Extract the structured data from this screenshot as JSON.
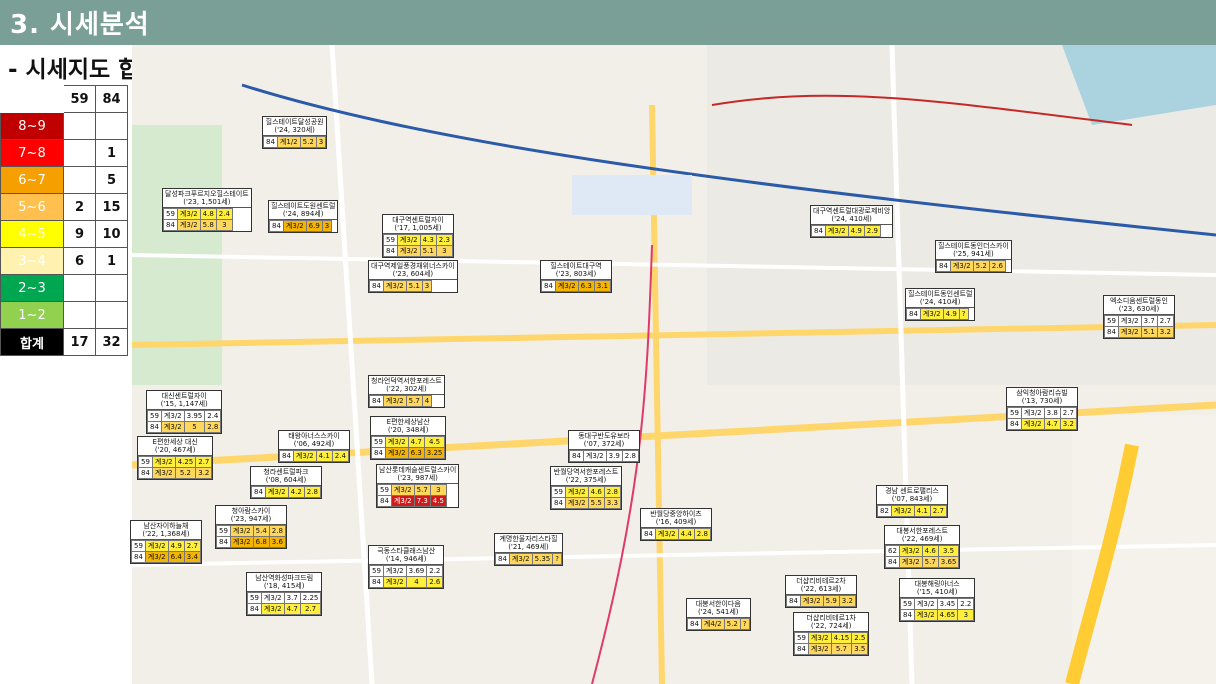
{
  "header": {
    "title": "3. 시세분석"
  },
  "subtitle": "- 시세지도 합치기",
  "legend": {
    "columns": [
      "59",
      "84"
    ],
    "rows": [
      {
        "label": "8~9",
        "color": "#c00000",
        "v59": "",
        "v84": ""
      },
      {
        "label": "7~8",
        "color": "#ff0000",
        "v59": "",
        "v84": "1"
      },
      {
        "label": "6~7",
        "color": "#f5a000",
        "v59": "",
        "v84": "5"
      },
      {
        "label": "5~6",
        "color": "#ffc04d",
        "v59": "2",
        "v84": "15"
      },
      {
        "label": "4~5",
        "color": "#ffff00",
        "v59": "9",
        "v84": "10"
      },
      {
        "label": "3~4",
        "color": "#fff2b0",
        "v59": "6",
        "v84": "1"
      },
      {
        "label": "2~3",
        "color": "#00a650",
        "v59": "",
        "v84": ""
      },
      {
        "label": "1~2",
        "color": "#92d050",
        "v59": "",
        "v84": ""
      }
    ],
    "total": {
      "label": "합계",
      "v59": "17",
      "v84": "32"
    }
  },
  "listings": [
    {
      "name": "힐스테이트달성공원",
      "year": "('24, 320세)",
      "rows": [
        [
          "84",
          "계1/2",
          "5.2",
          "3"
        ]
      ]
    },
    {
      "name": "달성파크푸르지오힐스테이트",
      "year": "('23, 1,501세)",
      "rows": [
        [
          "59",
          "계3/2",
          "4.8",
          "2.4"
        ],
        [
          "84",
          "계3/2",
          "5.8",
          "3"
        ]
      ]
    },
    {
      "name": "힐스테이트도원센트럴",
      "year": "('24, 894세)",
      "rows": [
        [
          "84",
          "계3/2",
          "6.9",
          "3"
        ]
      ]
    },
    {
      "name": "대구역센트럴자이",
      "year": "('17, 1,005세)",
      "rows": [
        [
          "59",
          "계3/2",
          "4.3",
          "2.3"
        ],
        [
          "84",
          "계3/2",
          "5.1",
          "3"
        ]
      ]
    },
    {
      "name": "대구역제일풍경채위너스카이",
      "year": "('23, 604세)",
      "rows": [
        [
          "84",
          "계3/2",
          "5.1",
          "3"
        ]
      ]
    },
    {
      "name": "힐스테이트대구역",
      "year": "('23, 803세)",
      "rows": [
        [
          "84",
          "계3/2",
          "6.3",
          "3.1"
        ]
      ]
    },
    {
      "name": "대구역센트럴대광로제비앙",
      "year": "('24, 410세)",
      "rows": [
        [
          "84",
          "계3/2",
          "4.9",
          "2.9"
        ]
      ]
    },
    {
      "name": "힐스테이트동인센트럴",
      "year": "('24, 410세)",
      "rows": [
        [
          "84",
          "계3/2",
          "4.9",
          "?"
        ]
      ]
    },
    {
      "name": "힐스테이트동인더스카이",
      "year": "('25, 941세)",
      "rows": [
        [
          "84",
          "계3/2",
          "5.2",
          "2.6"
        ]
      ]
    },
    {
      "name": "엑소디움센트럴동인",
      "year": "('23, 630세)",
      "rows": [
        [
          "59",
          "계3/2",
          "3.7",
          "2.7"
        ],
        [
          "84",
          "계3/2",
          "5.1",
          "3.2"
        ]
      ]
    },
    {
      "name": "청라언덕역서한포레스트",
      "year": "('22, 302세)",
      "rows": [
        [
          "84",
          "계3/2",
          "5.7",
          "4"
        ]
      ]
    },
    {
      "name": "대신센트럴자이",
      "year": "('15, 1,147세)",
      "rows": [
        [
          "59",
          "계3/2",
          "3.95",
          "2.4"
        ],
        [
          "84",
          "계3/2",
          "5",
          "2.8"
        ]
      ]
    },
    {
      "name": "E편한세상 대신",
      "year": "('20, 467세)",
      "rows": [
        [
          "59",
          "계3/2",
          "4.25",
          "2.7"
        ],
        [
          "84",
          "계3/2",
          "5.2",
          "3.2"
        ]
      ]
    },
    {
      "name": "태왕아너스스카이",
      "year": "('06, 492세)",
      "rows": [
        [
          "84",
          "계3/2",
          "4.1",
          "2.4"
        ]
      ]
    },
    {
      "name": "E편한세상남산",
      "year": "('20, 348세)",
      "rows": [
        [
          "59",
          "계3/2",
          "4.7",
          "4.5"
        ],
        [
          "84",
          "계3/2",
          "6.3",
          "3.25"
        ]
      ]
    },
    {
      "name": "청라센트럴파크",
      "year": "('08, 604세)",
      "rows": [
        [
          "84",
          "계3/2",
          "4.2",
          "2.8"
        ]
      ]
    },
    {
      "name": "남산롯데캐슬센트럴스카이",
      "year": "('23, 987세)",
      "rows": [
        [
          "59",
          "계3/2",
          "5.7",
          "3"
        ],
        [
          "84",
          "계3/2",
          "7.3",
          "4.5"
        ]
      ]
    },
    {
      "name": "동대구반도유보라",
      "year": "('07, 372세)",
      "rows": [
        [
          "84",
          "계3/2",
          "3.9",
          "2.8"
        ]
      ]
    },
    {
      "name": "반월당역서한포레스트",
      "year": "('22, 375세)",
      "rows": [
        [
          "59",
          "계3/2",
          "4.6",
          "2.8"
        ],
        [
          "84",
          "계3/2",
          "5.5",
          "3.3"
        ]
      ]
    },
    {
      "name": "반월당중앙하이츠",
      "year": "('16, 409세)",
      "rows": [
        [
          "84",
          "계3/2",
          "4.4",
          "2.8"
        ]
      ]
    },
    {
      "name": "청아람스카이",
      "year": "('23, 947세)",
      "rows": [
        [
          "59",
          "계3/2",
          "5.4",
          "2.8"
        ],
        [
          "84",
          "계3/2",
          "6.8",
          "3.6"
        ]
      ]
    },
    {
      "name": "남산자이하늘채",
      "year": "('22, 1,368세)",
      "rows": [
        [
          "59",
          "계3/2",
          "4.9",
          "2.7"
        ],
        [
          "84",
          "계3/2",
          "6.4",
          "3.4"
        ]
      ]
    },
    {
      "name": "남산역화성파크드림",
      "year": "('18, 415세)",
      "rows": [
        [
          "59",
          "계3/2",
          "3.7",
          "2.25"
        ],
        [
          "84",
          "계3/2",
          "4.7",
          "2.7"
        ]
      ]
    },
    {
      "name": "극동스타클래스남산",
      "year": "('14, 946세)",
      "rows": [
        [
          "59",
          "계3/2",
          "3.69",
          "2.2"
        ],
        [
          "84",
          "계3/2",
          "4",
          "2.6"
        ]
      ]
    },
    {
      "name": "계명한울자리스타힐",
      "year": "('21, 469세)",
      "rows": [
        [
          "84",
          "계3/2",
          "5.35",
          "?"
        ]
      ]
    },
    {
      "name": "삼익청아람리슈빌",
      "year": "('13, 730세)",
      "rows": [
        [
          "59",
          "계3/2",
          "3.8",
          "2.7"
        ],
        [
          "84",
          "계3/2",
          "4.7",
          "3.2"
        ]
      ]
    },
    {
      "name": "경남 센트로팰리스",
      "year": "('07, 843세)",
      "rows": [
        [
          "82",
          "계3/2",
          "4.1",
          "2.7"
        ]
      ]
    },
    {
      "name": "대봉서한포레스트",
      "year": "('22, 469세)",
      "rows": [
        [
          "62",
          "계3/2",
          "4.6",
          "3.5"
        ],
        [
          "84",
          "계3/2",
          "5.7",
          "3.65"
        ]
      ]
    },
    {
      "name": "더샵리비테르2차",
      "year": "('22, 613세)",
      "rows": [
        [
          "84",
          "계3/2",
          "5.9",
          "3.2"
        ]
      ]
    },
    {
      "name": "대봉해링아너스",
      "year": "('15, 410세)",
      "rows": [
        [
          "59",
          "계3/2",
          "3.45",
          "2.2"
        ],
        [
          "84",
          "계3/2",
          "4.65",
          "3"
        ]
      ]
    },
    {
      "name": "대봉서한이다음",
      "year": "('24, 541세)",
      "rows": [
        [
          "84",
          "계4/2",
          "5.2",
          "?"
        ]
      ]
    },
    {
      "name": "더샵리비테르1차",
      "year": "('22, 724세)",
      "rows": [
        [
          "59",
          "계3/2",
          "4.15",
          "2.5"
        ],
        [
          "84",
          "계3/2",
          "5.7",
          "3.5"
        ]
      ]
    }
  ]
}
